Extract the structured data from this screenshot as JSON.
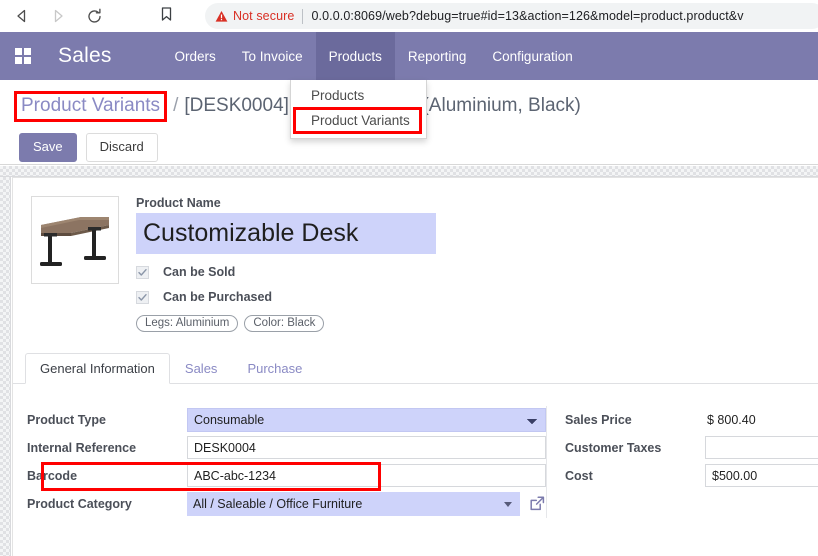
{
  "browser": {
    "back_icon": "back-arrow-icon",
    "forward_icon": "forward-arrow-icon",
    "reload_icon": "reload-icon",
    "bookmark_icon": "bookmark-icon",
    "security_warning": "Not secure",
    "url": "0.0.0.0:8069/web?debug=true#id=13&action=126&model=product.product&v"
  },
  "navbar": {
    "apps_icon": "apps-grid-icon",
    "brand": "Sales",
    "items": [
      {
        "label": "Orders",
        "active": false
      },
      {
        "label": "To Invoice",
        "active": false
      },
      {
        "label": "Products",
        "active": true
      },
      {
        "label": "Reporting",
        "active": false
      },
      {
        "label": "Configuration",
        "active": false
      }
    ]
  },
  "dropdown": {
    "items": [
      {
        "label": "Products",
        "highlighted": false
      },
      {
        "label": "Product Variants",
        "highlighted": true
      }
    ]
  },
  "control_panel": {
    "breadcrumb": {
      "parent": "Product Variants",
      "separator": "/",
      "current": "[DESK0004] Cu",
      "current_suffix": "(Aluminium, Black)"
    },
    "buttons": {
      "save": "Save",
      "discard": "Discard"
    }
  },
  "form": {
    "product_image_alt": "customizable-desk-photo",
    "product_name_label": "Product Name",
    "product_name_value": "Customizable Desk",
    "checkboxes": [
      {
        "label": "Can be Sold",
        "checked": true
      },
      {
        "label": "Can be Purchased",
        "checked": true
      }
    ],
    "tags": [
      "Legs: Aluminium",
      "Color: Black"
    ],
    "tabs": [
      {
        "label": "General Information",
        "active": true
      },
      {
        "label": "Sales",
        "active": false
      },
      {
        "label": "Purchase",
        "active": false
      }
    ],
    "left_fields": {
      "product_type_label": "Product Type",
      "product_type_value": "Consumable",
      "internal_reference_label": "Internal Reference",
      "internal_reference_value": "DESK0004",
      "barcode_label": "Barcode",
      "barcode_value": "ABC-abc-1234",
      "product_category_label": "Product Category",
      "product_category_value": "All / Saleable / Office Furniture",
      "external_link_icon": "external-link-icon"
    },
    "right_fields": {
      "sales_price_label": "Sales Price",
      "sales_price_value": "$ 800.40",
      "customer_taxes_label": "Customer Taxes",
      "customer_taxes_value": "",
      "cost_label": "Cost",
      "cost_value": "$500.00"
    }
  },
  "colors": {
    "odoo_purple": "#7c7bad",
    "odoo_purple_active": "#6b6a9c",
    "field_lavender": "#ced3fa",
    "highlight_red": "#ff0000",
    "not_secure_red": "#d93025"
  }
}
